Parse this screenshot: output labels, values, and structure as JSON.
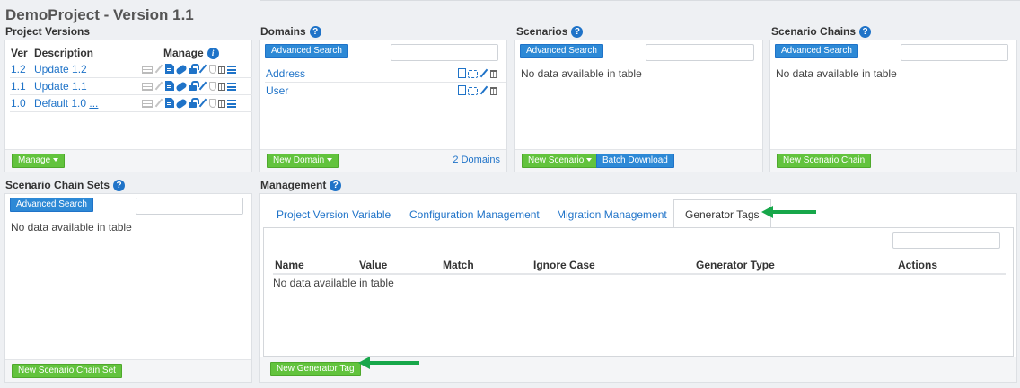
{
  "page_title": "DemoProject - Version 1.1",
  "project_versions": {
    "title": "Project Versions",
    "columns": {
      "ver": "Ver",
      "description": "Description",
      "manage": "Manage"
    },
    "rows": [
      {
        "ver": "1.2",
        "description": "Update 1.2",
        "suffix": ""
      },
      {
        "ver": "1.1",
        "description": "Update 1.1",
        "suffix": ""
      },
      {
        "ver": "1.0",
        "description": "Default 1.0",
        "suffix": "..."
      }
    ],
    "manage_button": "Manage"
  },
  "domains": {
    "title": "Domains",
    "advanced_search": "Advanced Search",
    "items": [
      "Address",
      "User"
    ],
    "new_button": "New Domain",
    "count": "2 Domains"
  },
  "scenarios": {
    "title": "Scenarios",
    "advanced_search": "Advanced Search",
    "empty": "No data available in table",
    "new_button": "New Scenario",
    "batch_button": "Batch Download"
  },
  "scenario_chains": {
    "title": "Scenario Chains",
    "advanced_search": "Advanced Search",
    "empty": "No data available in table",
    "new_button": "New Scenario Chain"
  },
  "scenario_chain_sets": {
    "title": "Scenario Chain Sets",
    "advanced_search": "Advanced Search",
    "empty": "No data available in table",
    "new_button": "New Scenario Chain Set"
  },
  "management": {
    "title": "Management",
    "tabs": [
      "Project Version Variable",
      "Configuration Management",
      "Migration Management",
      "Generator Tags"
    ],
    "active_tab": "Generator Tags",
    "columns": [
      "Name",
      "Value",
      "Match",
      "Ignore Case",
      "Generator Type",
      "Actions"
    ],
    "empty": "No data available in table",
    "new_button": "New Generator Tag"
  },
  "colors": {
    "accent_blue": "#1f73c8",
    "button_green": "#62c33d",
    "arrow_green": "#17a74a"
  }
}
